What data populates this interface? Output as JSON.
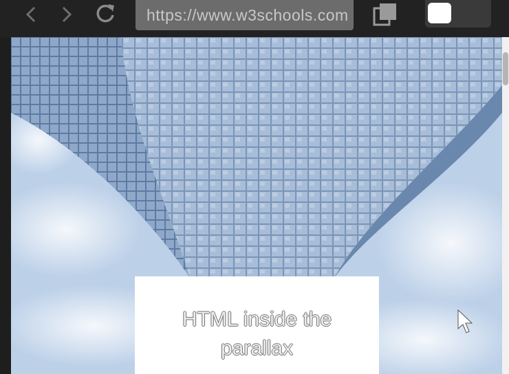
{
  "browser": {
    "url": "https://www.w3schools.com",
    "back_icon": "chevron-left-icon",
    "forward_icon": "chevron-right-icon",
    "reload_icon": "reload-icon",
    "tabs_icon": "tabs-icon",
    "menu_icon": "menu-icon"
  },
  "page": {
    "heading": "HTML inside the parallax",
    "hero_image": "skyscraper-glass-facade-looking-up"
  },
  "colors": {
    "toolbar": "#222222",
    "url_bar": "#6c6c6c",
    "sky": "#c9d9ee",
    "building": "#3f5f86"
  }
}
